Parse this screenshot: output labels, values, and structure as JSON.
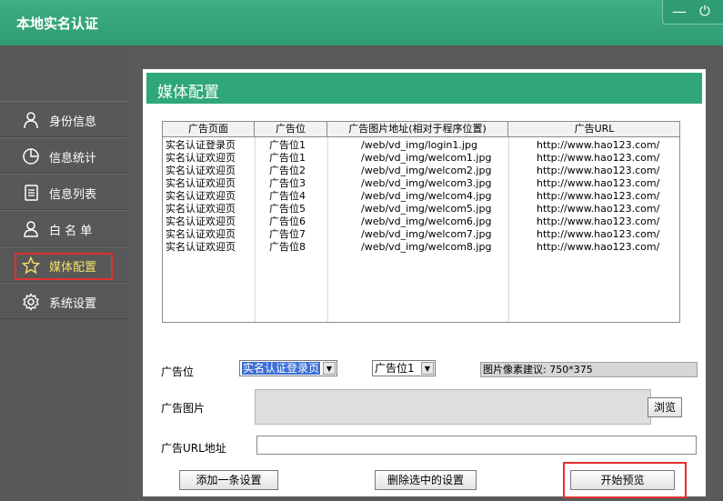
{
  "window": {
    "title": "本地实名认证",
    "minimize_glyph": "—",
    "power_glyph": "⏻"
  },
  "sidebar": {
    "items": [
      {
        "label": "身份信息",
        "icon": "person-icon"
      },
      {
        "label": "信息统计",
        "icon": "pie-chart-icon"
      },
      {
        "label": "信息列表",
        "icon": "document-list-icon"
      },
      {
        "label": "白 名 单",
        "icon": "user-outline-icon"
      },
      {
        "label": "媒体配置",
        "icon": "star-icon",
        "active": true
      },
      {
        "label": "系统设置",
        "icon": "gear-icon"
      }
    ]
  },
  "panel": {
    "title": "媒体配置",
    "table": {
      "headers": [
        "广告页面",
        "广告位",
        "广告图片地址(相对于程序位置)",
        "广告URL"
      ],
      "rows": [
        [
          "实名认证登录页",
          "广告位1",
          "/web/vd_img/login1.jpg",
          "http://www.hao123.com/"
        ],
        [
          "实名认证欢迎页",
          "广告位1",
          "/web/vd_img/welcom1.jpg",
          "http://www.hao123.com/"
        ],
        [
          "实名认证欢迎页",
          "广告位2",
          "/web/vd_img/welcom2.jpg",
          "http://www.hao123.com/"
        ],
        [
          "实名认证欢迎页",
          "广告位3",
          "/web/vd_img/welcom3.jpg",
          "http://www.hao123.com/"
        ],
        [
          "实名认证欢迎页",
          "广告位4",
          "/web/vd_img/welcom4.jpg",
          "http://www.hao123.com/"
        ],
        [
          "实名认证欢迎页",
          "广告位5",
          "/web/vd_img/welcom5.jpg",
          "http://www.hao123.com/"
        ],
        [
          "实名认证欢迎页",
          "广告位6",
          "/web/vd_img/welcom6.jpg",
          "http://www.hao123.com/"
        ],
        [
          "实名认证欢迎页",
          "广告位7",
          "/web/vd_img/welcom7.jpg",
          "http://www.hao123.com/"
        ],
        [
          "实名认证欢迎页",
          "广告位8",
          "/web/vd_img/welcom8.jpg",
          "http://www.hao123.com/"
        ]
      ]
    },
    "form": {
      "ad_slot_label": "广告位",
      "page_select_value": "实名认证登录页",
      "slot_select_value": "广告位1",
      "pixel_hint": "图片像素建议: 750*375",
      "ad_image_label": "广告图片",
      "browse_button": "浏览",
      "ad_url_label": "广告URL地址",
      "ad_url_value": ""
    },
    "buttons": {
      "add": "添加一条设置",
      "delete": "删除选中的设置",
      "preview": "开始预览"
    }
  },
  "colors": {
    "accent": "#2fa77a",
    "sidebar": "#585858",
    "highlight": "#e23030",
    "active_label": "#f3e06a"
  }
}
